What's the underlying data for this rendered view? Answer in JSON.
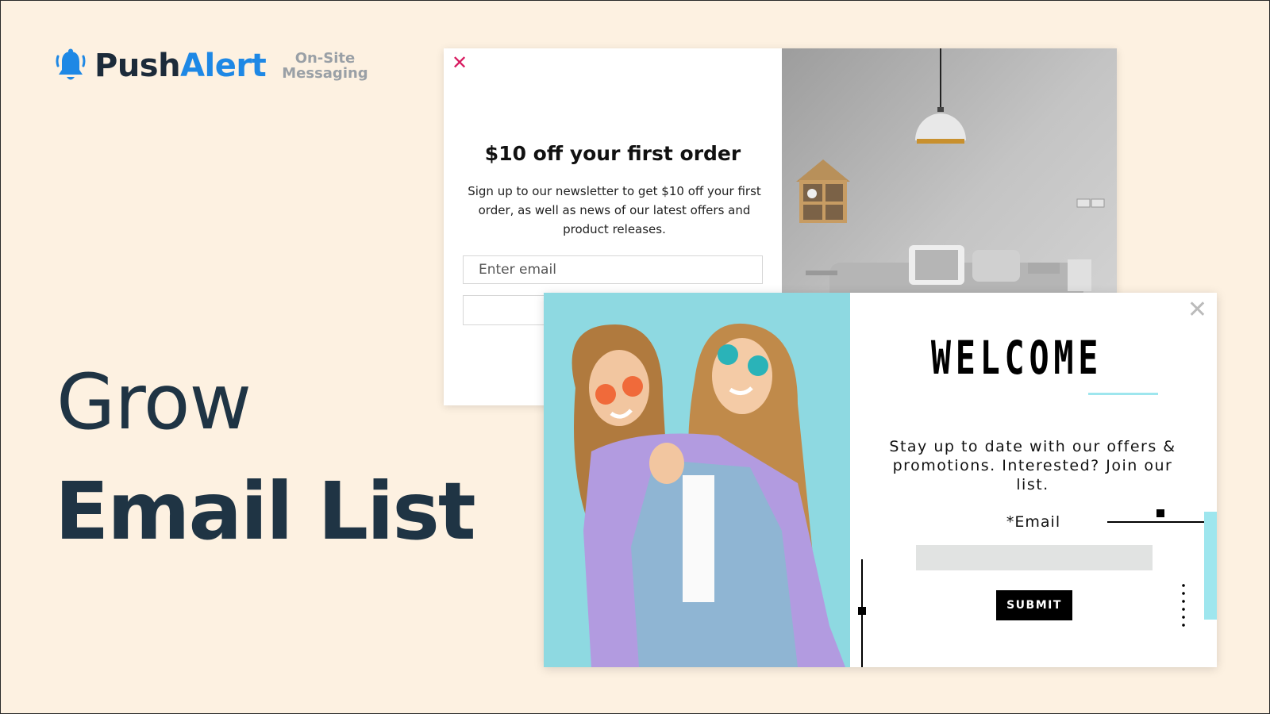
{
  "logo": {
    "push": "Push",
    "alert": "Alert",
    "tag_line1": "On-Site",
    "tag_line2": "Messaging",
    "accent": "#1e88e5",
    "dark": "#1c2b3a"
  },
  "headline": {
    "line1": "Grow",
    "line2": "Email List",
    "color": "#1f3444"
  },
  "popup1": {
    "close_icon": "close-icon",
    "title": "$10 off your first order",
    "description": "Sign up to our newsletter to get $10 off your first order, as well as news of our latest offers and product releases.",
    "email_placeholder": "Enter email",
    "close_color": "#d81b60"
  },
  "popup2": {
    "title": "WELCOME",
    "text": "Stay up to date with our offers & promotions. Interested? Join our list.",
    "email_label": "*Email",
    "submit_label": "SUBMIT",
    "accent": "#9ee6ee"
  },
  "background": "#fdf1e1"
}
